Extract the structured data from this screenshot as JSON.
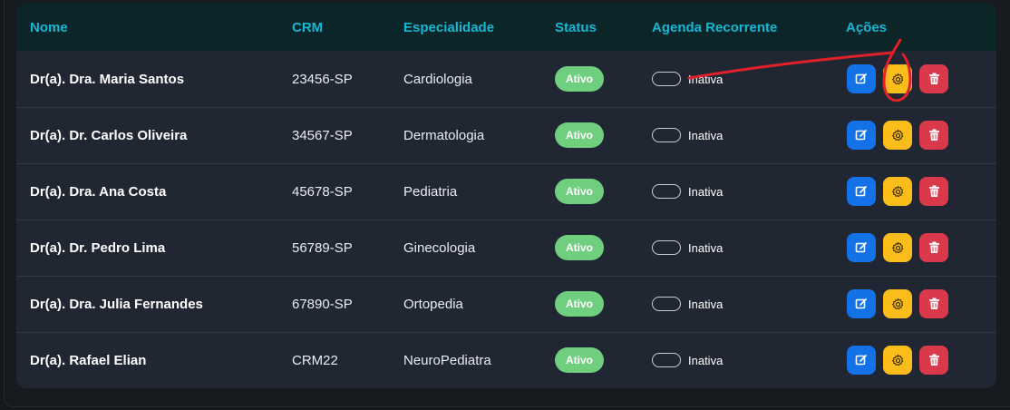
{
  "table": {
    "headers": {
      "name": "Nome",
      "crm": "CRM",
      "specialty": "Especialidade",
      "status": "Status",
      "schedule": "Agenda Recorrente",
      "actions": "Ações"
    },
    "rows": [
      {
        "name": "Dr(a). Dra. Maria Santos",
        "crm": "23456-SP",
        "specialty": "Cardiologia",
        "status": "Ativo",
        "schedule": "Inativa"
      },
      {
        "name": "Dr(a). Dr. Carlos Oliveira",
        "crm": "34567-SP",
        "specialty": "Dermatologia",
        "status": "Ativo",
        "schedule": "Inativa"
      },
      {
        "name": "Dr(a). Dra. Ana Costa",
        "crm": "45678-SP",
        "specialty": "Pediatria",
        "status": "Ativo",
        "schedule": "Inativa"
      },
      {
        "name": "Dr(a). Dr. Pedro Lima",
        "crm": "56789-SP",
        "specialty": "Ginecologia",
        "status": "Ativo",
        "schedule": "Inativa"
      },
      {
        "name": "Dr(a). Dra. Julia Fernandes",
        "crm": "67890-SP",
        "specialty": "Ortopedia",
        "status": "Ativo",
        "schedule": "Inativa"
      },
      {
        "name": "Dr(a). Rafael Elian",
        "crm": "CRM22",
        "specialty": "NeuroPediatra",
        "status": "Ativo",
        "schedule": "Inativa"
      }
    ]
  },
  "icons": {
    "edit": "edit-icon",
    "config": "gear-icon",
    "delete": "trash-icon"
  },
  "colors": {
    "header_text": "#14b8d4",
    "status_active": "#6fcf7f",
    "edit_button": "#1372e8",
    "config_button": "#fbbd1a",
    "delete_button": "#d9394b",
    "annotation": "#e0202a"
  }
}
